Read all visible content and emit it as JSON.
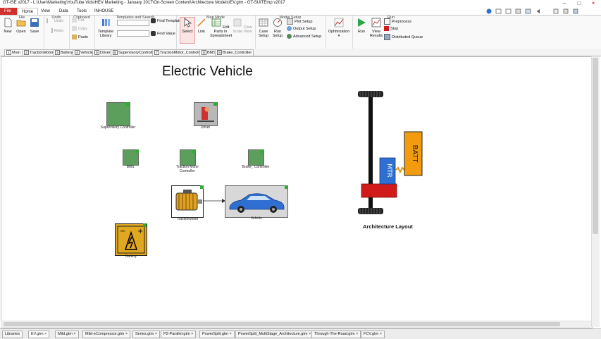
{
  "window": {
    "title": "GT-ISE v2017 - L:\\User\\Marketing\\YouTube Vids\\HEV Marketing - January 2017\\On-Screen Content\\Architecture Models\\EV.gtm - GT-SUITEmp v2017"
  },
  "ribbon_tabs": [
    "File",
    "Home",
    "View",
    "Data",
    "Tools",
    "INHOUSE"
  ],
  "ribbon": {
    "file": {
      "new": "New",
      "open": "Open",
      "save": "Save",
      "group": "File"
    },
    "undo": {
      "undo": "Undo",
      "redo": "Redo",
      "group": "Undo"
    },
    "clipboard": {
      "cut": "Cut",
      "copy": "Copy",
      "paste": "Paste",
      "group": "Clipboard"
    },
    "templates": {
      "library": "Template Library",
      "find_template": "Find Template",
      "find_value": "Find Value",
      "group": "Templates and Search"
    },
    "mapmode": {
      "select": "Select",
      "link": "Link",
      "edit_parts": "Edit Parts in Spreadsheet",
      "flow_scale": "Flow Scale View",
      "group": "Map Mode"
    },
    "model_setup": {
      "case_setup": "Case Setup",
      "run_setup": "Run Setup",
      "plot_setup": "Plot Setup",
      "output_setup": "Output Setup",
      "advanced_setup": "Advanced Setup",
      "group": "Model Setup"
    },
    "optimization": {
      "label": "Optimization"
    },
    "run": {
      "run": "Run",
      "view_results": "View Results",
      "preprocess": "Preprocess",
      "stop": "Stop",
      "distributed_queue": "Distributed Queue",
      "group": "Run"
    }
  },
  "doc_tabs": [
    {
      "n": "1",
      "label": "Main"
    },
    {
      "n": "2",
      "label": "TractionMotor"
    },
    {
      "n": "3",
      "label": "Battery"
    },
    {
      "n": "4",
      "label": "Vehicle"
    },
    {
      "n": "5",
      "label": "Driver"
    },
    {
      "n": "6",
      "label": "SupervisoryController"
    },
    {
      "n": "7",
      "label": "TractionMotor_Controller"
    },
    {
      "n": "8",
      "label": "BMS"
    },
    {
      "n": "9",
      "label": "Brake_Controller"
    }
  ],
  "canvas": {
    "title": "Electric Vehicle",
    "components": {
      "supervisory": "Supervisory Controller",
      "driver": "Driver",
      "bms": "BMS",
      "traction_controller": "Traction Motor Controller",
      "brake_controller": "Brake_ Controller",
      "traction_motor": "TractionMotor",
      "vehicle": "Vehicle",
      "battery": "Battery"
    },
    "architecture": {
      "mtr": "MTR",
      "batt": "BATT",
      "caption": "Architecture Layout"
    },
    "colors": {
      "batt": "#f29b0d",
      "mtr": "#2f6fd1",
      "gearbox": "#d11a1a"
    }
  },
  "bottom_tabs": [
    "Libraries",
    "EV.gtm",
    "Mild.gtm",
    "Mild-eCompressor.gtm",
    "Series.gtm",
    "P2-Parallel.gtm",
    "PowerSplit.gtm",
    "PowerSplit_MultiStage_Architecture.gtm",
    "Through-The-Road.gtm",
    "FCV.gtm"
  ]
}
